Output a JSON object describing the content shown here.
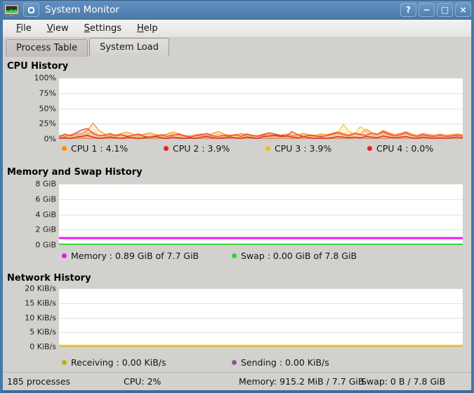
{
  "window": {
    "title": "System Monitor",
    "buttons": {
      "help": "?",
      "minimize": "−",
      "maximize": "□",
      "close": "×"
    }
  },
  "menu": {
    "items": [
      {
        "label": "File"
      },
      {
        "label": "View"
      },
      {
        "label": "Settings"
      },
      {
        "label": "Help"
      }
    ]
  },
  "tabs": [
    {
      "label": "Process Table"
    },
    {
      "label": "System Load"
    }
  ],
  "sections": {
    "cpu": {
      "title": "CPU History"
    },
    "memory": {
      "title": "Memory and Swap History"
    },
    "network": {
      "title": "Network History"
    }
  },
  "chart_data": {
    "cpu": {
      "type": "area",
      "ylim": [
        0,
        100
      ],
      "y_ticks": [
        "100%",
        "75%",
        "50%",
        "25%",
        "0%"
      ],
      "series": [
        {
          "name": "CPU 1",
          "color": "#fb9a40",
          "width": 1.5,
          "fill": true,
          "values": [
            6,
            5,
            7,
            9,
            8,
            14,
            26,
            14,
            8,
            6,
            7,
            9,
            11,
            8,
            6,
            8,
            10,
            7,
            6,
            8,
            11,
            9,
            6,
            5,
            7,
            8,
            6,
            9,
            12,
            8,
            6,
            7,
            9,
            7,
            5,
            6,
            8,
            10,
            7,
            6,
            8,
            6,
            7,
            9,
            7,
            6,
            8,
            7,
            9,
            12,
            9,
            7,
            10,
            8,
            16,
            10,
            8,
            14,
            10,
            7,
            9,
            12,
            8,
            6,
            9,
            7,
            6,
            8,
            6,
            7,
            8,
            7
          ]
        },
        {
          "name": "CPU 3",
          "color": "#f5cd42",
          "width": 1.5,
          "fill": true,
          "values": [
            4,
            3,
            5,
            6,
            5,
            8,
            12,
            7,
            5,
            4,
            6,
            5,
            7,
            5,
            4,
            6,
            7,
            5,
            4,
            6,
            8,
            6,
            4,
            3,
            5,
            6,
            4,
            6,
            8,
            5,
            4,
            6,
            7,
            5,
            3,
            5,
            6,
            7,
            5,
            4,
            6,
            4,
            5,
            7,
            5,
            4,
            6,
            5,
            7,
            9,
            24,
            12,
            8,
            20,
            12,
            6,
            8,
            10,
            6,
            5,
            7,
            9,
            6,
            4,
            6,
            5,
            4,
            6,
            4,
            5,
            6,
            5
          ]
        },
        {
          "name": "CPU 2",
          "color": "#ef4b41",
          "width": 1.5,
          "fill": true,
          "values": [
            3,
            8,
            5,
            10,
            15,
            17,
            9,
            5,
            6,
            9,
            5,
            7,
            4,
            6,
            8,
            4,
            3,
            5,
            7,
            4,
            6,
            8,
            5,
            3,
            5,
            7,
            9,
            5,
            4,
            6,
            5,
            7,
            4,
            8,
            6,
            4,
            7,
            10,
            8,
            6,
            5,
            12,
            7,
            4,
            6,
            5,
            4,
            5,
            8,
            10,
            7,
            5,
            9,
            7,
            6,
            10,
            7,
            12,
            8,
            5,
            7,
            10,
            6,
            4,
            7,
            5,
            4,
            6,
            4,
            5,
            6,
            5
          ]
        },
        {
          "name": "CPU 4",
          "color": "#d63127",
          "width": 1.5,
          "fill": true,
          "values": [
            1,
            2,
            1,
            3,
            4,
            6,
            3,
            1,
            2,
            3,
            2,
            1,
            3,
            2,
            1,
            2,
            3,
            4,
            2,
            1,
            3,
            2,
            1,
            2,
            1,
            3,
            4,
            2,
            1,
            2,
            3,
            2,
            1,
            3,
            2,
            1,
            4,
            5,
            6,
            4,
            5,
            3,
            2,
            4,
            2,
            1,
            2,
            1,
            2,
            4,
            3,
            2,
            3,
            2,
            4,
            3,
            2,
            5,
            3,
            2,
            3,
            4,
            2,
            1,
            3,
            2,
            1,
            2,
            1,
            2,
            3,
            2
          ]
        }
      ]
    },
    "memory": {
      "type": "line",
      "ylim": [
        0,
        8
      ],
      "y_ticks": [
        "8 GiB",
        "6 GiB",
        "4 GiB",
        "2 GiB",
        "0 GiB"
      ],
      "series": [
        {
          "name": "Memory",
          "color": "#f31bf0",
          "width": 3,
          "fill": false,
          "values": [
            0.89,
            0.89
          ]
        },
        {
          "name": "Swap",
          "color": "#2ed52e",
          "width": 2,
          "fill": false,
          "values": [
            0.08,
            0.08
          ]
        }
      ]
    },
    "network": {
      "type": "line",
      "ylim": [
        0,
        20
      ],
      "y_ticks": [
        "20 KiB/s",
        "15 KiB/s",
        "10 KiB/s",
        "5 KiB/s",
        "0 KiB/s"
      ],
      "series": [
        {
          "name": "Sending",
          "color": "#9a4f9e",
          "width": 2,
          "fill": false,
          "values": [
            0.05,
            0.05
          ]
        },
        {
          "name": "Receiving",
          "color": "#e8d41c",
          "width": 2.5,
          "fill": false,
          "values": [
            0.35,
            0.35
          ]
        }
      ]
    }
  },
  "legends": {
    "cpu": [
      {
        "color": "#ff8c0a",
        "label": "CPU 1 : 4.1%"
      },
      {
        "color": "#e8231e",
        "label": "CPU 2 : 3.9%"
      },
      {
        "color": "#f2c211",
        "label": "CPU 3 : 3.9%"
      },
      {
        "color": "#e8231e",
        "label": "CPU 4 : 0.0%"
      }
    ],
    "memory": [
      {
        "color": "#e21fdc",
        "label": "Memory : 0.89 GiB of 7.7 GiB"
      },
      {
        "color": "#2ed52e",
        "label": "Swap : 0.00 GiB of 7.8 GiB"
      }
    ],
    "network": [
      {
        "color": "#bfae1a",
        "label": "Receiving : 0.00 KiB/s"
      },
      {
        "color": "#96539b",
        "label": "Sending : 0.00 KiB/s"
      }
    ]
  },
  "statusbar": {
    "processes": "185 processes",
    "cpu": "CPU: 2%",
    "memory": "Memory: 915.2 MiB / 7.7 GiB",
    "swap": "Swap: 0 B / 7.8 GiB"
  }
}
